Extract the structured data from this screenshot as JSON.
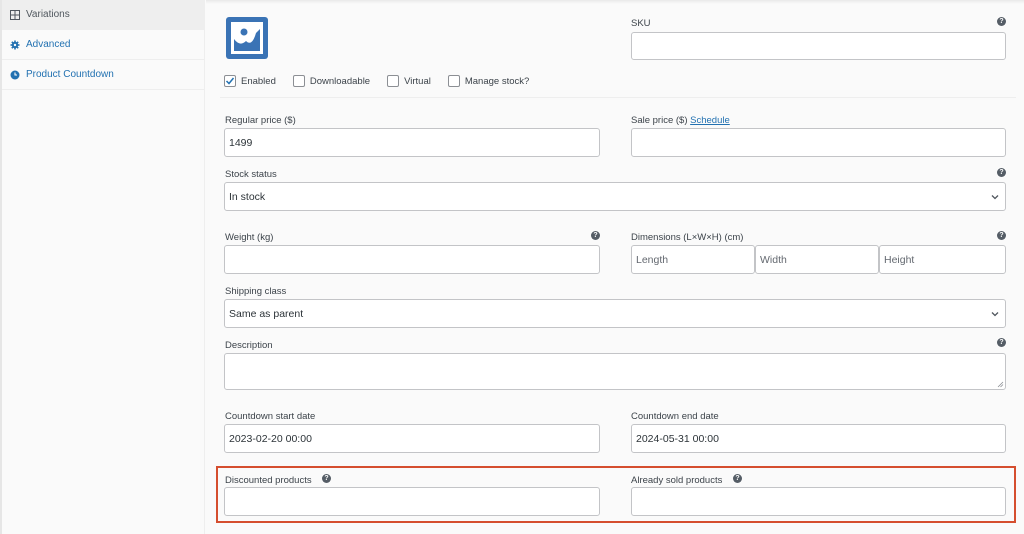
{
  "sidebar": {
    "items": [
      {
        "label": "Variations",
        "icon": "grid-icon",
        "active": true
      },
      {
        "label": "Advanced",
        "icon": "gear-icon",
        "active": false
      },
      {
        "label": "Product Countdown",
        "icon": "clock-icon",
        "active": false
      }
    ]
  },
  "variation": {
    "image_icon": "image-placeholder-icon",
    "sku": {
      "label": "SKU",
      "value": ""
    },
    "checkboxes": [
      {
        "label": "Enabled",
        "checked": true
      },
      {
        "label": "Downloadable",
        "checked": false
      },
      {
        "label": "Virtual",
        "checked": false
      },
      {
        "label": "Manage stock?",
        "checked": false
      }
    ],
    "regular_price": {
      "label": "Regular price ($)",
      "value": "1499"
    },
    "sale_price": {
      "label": "Sale price ($)",
      "schedule_link": "Schedule",
      "value": ""
    },
    "stock_status": {
      "label": "Stock status",
      "value": "In stock"
    },
    "weight": {
      "label": "Weight (kg)",
      "value": ""
    },
    "dimensions": {
      "label": "Dimensions (L×W×H) (cm)",
      "length_placeholder": "Length",
      "width_placeholder": "Width",
      "height_placeholder": "Height"
    },
    "shipping_class": {
      "label": "Shipping class",
      "value": "Same as parent"
    },
    "description": {
      "label": "Description",
      "value": ""
    },
    "countdown_start": {
      "label": "Countdown start date",
      "value": "2023-02-20 00:00"
    },
    "countdown_end": {
      "label": "Countdown end date",
      "value": "2024-05-31 00:00"
    },
    "discounted_products": {
      "label": "Discounted products",
      "value": ""
    },
    "already_sold": {
      "label": "Already sold products",
      "value": ""
    }
  },
  "colors": {
    "accent": "#2271b1",
    "highlight_border": "#d54e2f"
  }
}
